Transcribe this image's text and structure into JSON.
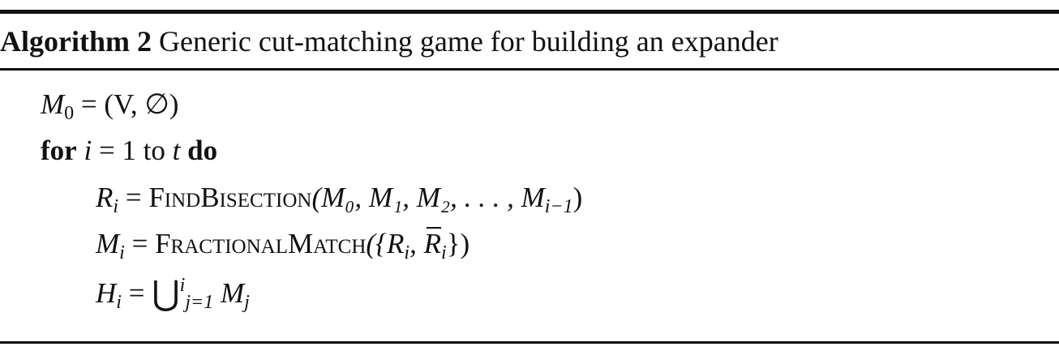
{
  "algorithm": {
    "label": "Algorithm 2",
    "title": "Generic cut-matching game for building an expander"
  },
  "lines": {
    "m0_lhs": "M",
    "m0_sub": "0",
    "m0_rhs": " = (V, ∅)",
    "for_kw": "for",
    "for_var": "i",
    "for_range": " = 1 to ",
    "for_end": "t",
    "do_kw": "do",
    "r_lhs": "R",
    "r_sub": "i",
    "r_func": "FindBisection",
    "r_args": "(M₀, M₁, M₂, . . . , M",
    "r_args_sub": "i−1",
    "r_close": ")",
    "m_lhs": "M",
    "m_sub": "i",
    "m_func": "FractionalMatch",
    "m_args_open": "({R",
    "m_args_sub1": "i",
    "m_args_mid": ", R",
    "m_args_sub2": "i",
    "m_args_close": "})",
    "h_lhs": "H",
    "h_sub": "i",
    "h_eq": " = ",
    "h_cup": "⋃",
    "h_sup": "i",
    "h_lower": "j=1",
    "h_term": " M",
    "h_term_sub": "j"
  }
}
